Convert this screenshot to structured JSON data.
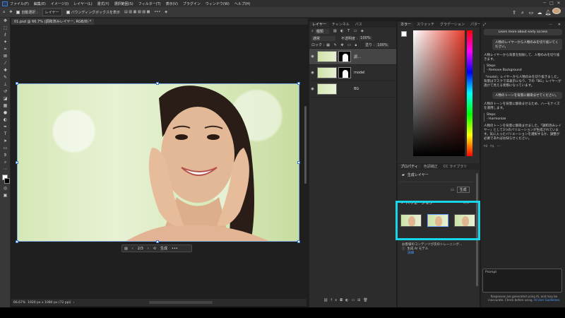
{
  "menubar": {
    "items": [
      "ファイル(F)",
      "編集(E)",
      "イメージ(I)",
      "レイヤー(L)",
      "書式(Y)",
      "選択範囲(S)",
      "フィルター(T)",
      "表示(V)",
      "プラグイン",
      "ウィンドウ(W)",
      "ヘルプ(H)"
    ]
  },
  "optionsbar": {
    "auto_select": "自動選択 :",
    "layer_select": "レイヤー",
    "bounding_box": "バウンディングボックスを表示"
  },
  "document": {
    "tab_title": "01.psd @ 66.7% (調和済みレイヤー, RGB/8) *",
    "zoom": "66.67%",
    "dimensions": "1920 px x 1080 px (72 ppi)"
  },
  "context_bar": {
    "counter": "2/3",
    "generate": "生成"
  },
  "layers_panel": {
    "tabs": [
      "レイヤー",
      "チャンネル",
      "パス"
    ],
    "filter_label": "種類",
    "blend_mode": "通常",
    "opacity_label": "不透明度 :",
    "opacity_value": "100%",
    "lock_label": "ロック :",
    "fill_label": "塗り :",
    "fill_value": "100%",
    "layers": [
      {
        "name": "調…"
      },
      {
        "name": "model"
      },
      {
        "name": "BG"
      }
    ]
  },
  "color_panel": {
    "tabs": [
      "カラー",
      "スウォッチ",
      "グラデーション",
      "パターン"
    ]
  },
  "properties_panel": {
    "tabs": [
      "プロパティ",
      "色調補正",
      "CC ライブラリ"
    ],
    "layer_type": "生成レイヤー",
    "generate_button": "生成",
    "variation_label": "バリエーション",
    "variation_count": "3/3",
    "model_text": "お客様のコンテンツが次のトレーニング…",
    "model_name": "生成 AI モデル",
    "details_link": "詳細"
  },
  "assistant": {
    "learn_more": "Learn more about early access",
    "user_msg_1": "人物のレイヤーから人物のみを切り抜いてください。",
    "reply_1": "人物レイヤーから背景を削除して、人物のみを切り抜きます。",
    "steps_label": "Steps",
    "step_1": "- Remove Background",
    "result_1": "「model」レイヤーから人物のみを切り抜きました。背景はマスクで非表示になり、下の「BG」レイヤーが透けて見える状態になっています。",
    "user_msg_2": "人物のトーンを背景に馴染ませてください。",
    "reply_2": "人物のトーンを背景に馴染ませるため、ハーモナイズを適用します。",
    "steps_label_2": "Steps",
    "step_2": "- Harmonize",
    "result_2": "人物のトーンを背景に馴染ませました。「調和済みレイヤー」として3つのバリエーションが生成されています。気に入ったバリエーションを選択するか、調整が必要であればお知らせください。",
    "prompt_label": "Prompt",
    "disclaimer": "Responses are generated using AI, and may be inaccurate. Check before using.",
    "guidelines": "AI User Guidelines"
  },
  "colors": {
    "accent_highlight": "#1ad4ea",
    "selection_blue": "#3a78d4"
  }
}
